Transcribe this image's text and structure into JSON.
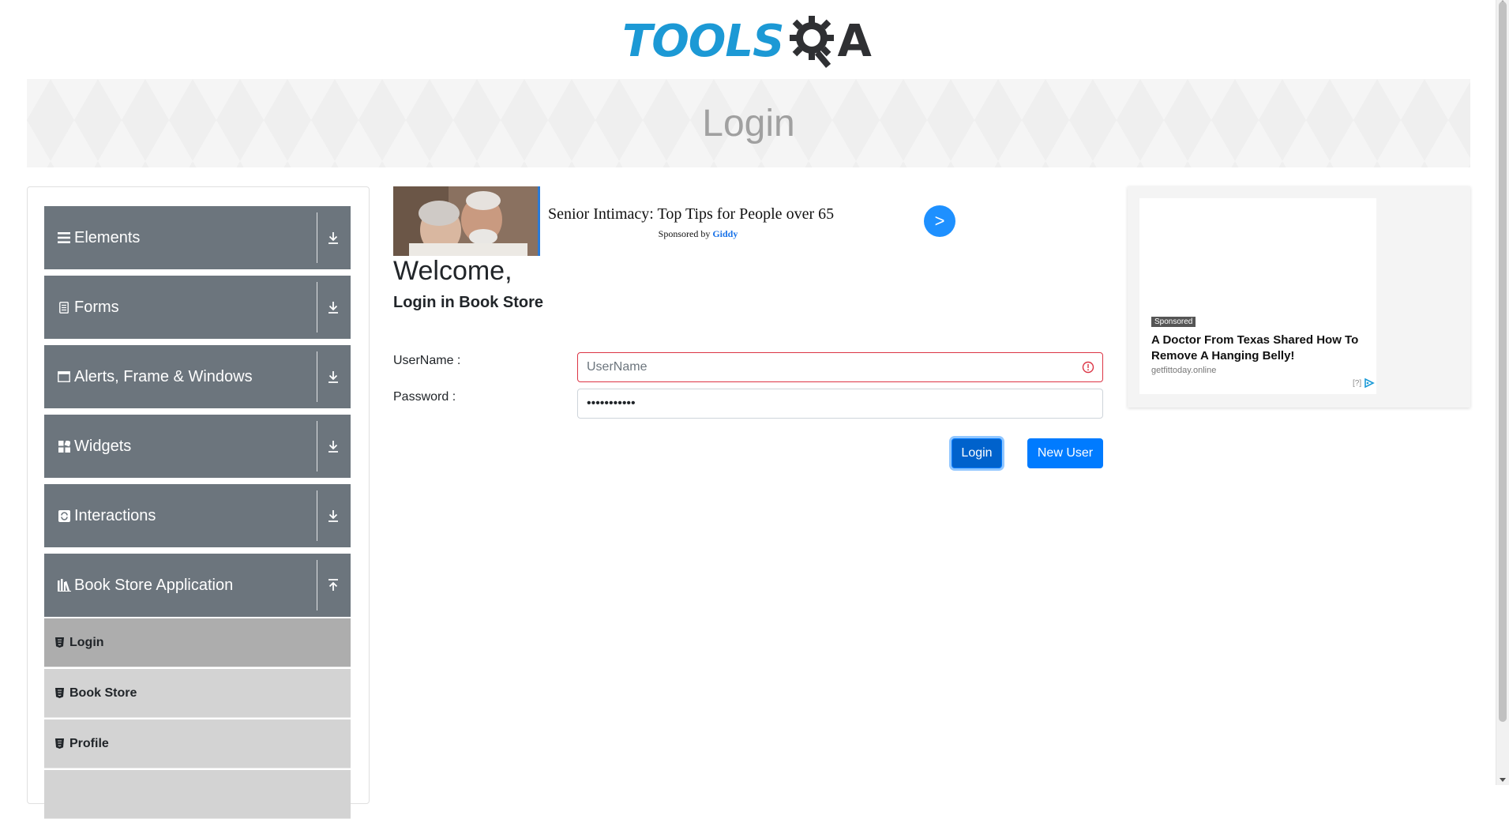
{
  "header": {
    "logo_text_left": "TOOLS",
    "logo_text_right": "A",
    "logo_brand": "TOOLSQA",
    "page_title": "Login"
  },
  "sidebar": {
    "groups": [
      {
        "label": "Elements",
        "icon": "hamburger-icon",
        "arrow": "download-arrow-icon"
      },
      {
        "label": "Forms",
        "icon": "document-icon",
        "arrow": "download-arrow-icon"
      },
      {
        "label": "Alerts, Frame & Windows",
        "icon": "window-icon",
        "arrow": "download-arrow-icon"
      },
      {
        "label": "Widgets",
        "icon": "widgets-icon",
        "arrow": "download-arrow-icon"
      },
      {
        "label": "Interactions",
        "icon": "interactions-icon",
        "arrow": "download-arrow-icon"
      },
      {
        "label": "Book Store Application",
        "icon": "books-icon",
        "arrow": "upload-arrow-icon"
      }
    ],
    "sub_items": [
      {
        "label": "Login",
        "icon": "html5-icon",
        "active": true
      },
      {
        "label": "Book Store",
        "icon": "html5-icon",
        "active": false
      },
      {
        "label": "Profile",
        "icon": "html5-icon",
        "active": false
      }
    ]
  },
  "top_ad": {
    "headline": "Senior Intimacy: Top Tips for People over 65",
    "sponsored_prefix": "Sponsored by",
    "sponsor": "Giddy",
    "go_label": ">"
  },
  "main": {
    "welcome": "Welcome,",
    "subtitle": "Login in Book Store",
    "username_label": "UserName :",
    "username_placeholder": "UserName",
    "username_value": "",
    "password_label": "Password :",
    "password_value": "•••••••••••",
    "login_button": "Login",
    "new_user_button": "New User"
  },
  "right_ad": {
    "badge": "Sponsored",
    "title": "A Doctor From Texas Shared How To Remove A Hanging Belly!",
    "domain": "getfittoday.online",
    "adchoice": "[?]"
  },
  "colors": {
    "primary": "#007bff",
    "sidebar_group": "#6c757d",
    "sidebar_sub": "#d3d3d3",
    "sidebar_sub_active": "#adadad",
    "invalid": "#dc3545",
    "logo_blue": "#1c99d5"
  }
}
